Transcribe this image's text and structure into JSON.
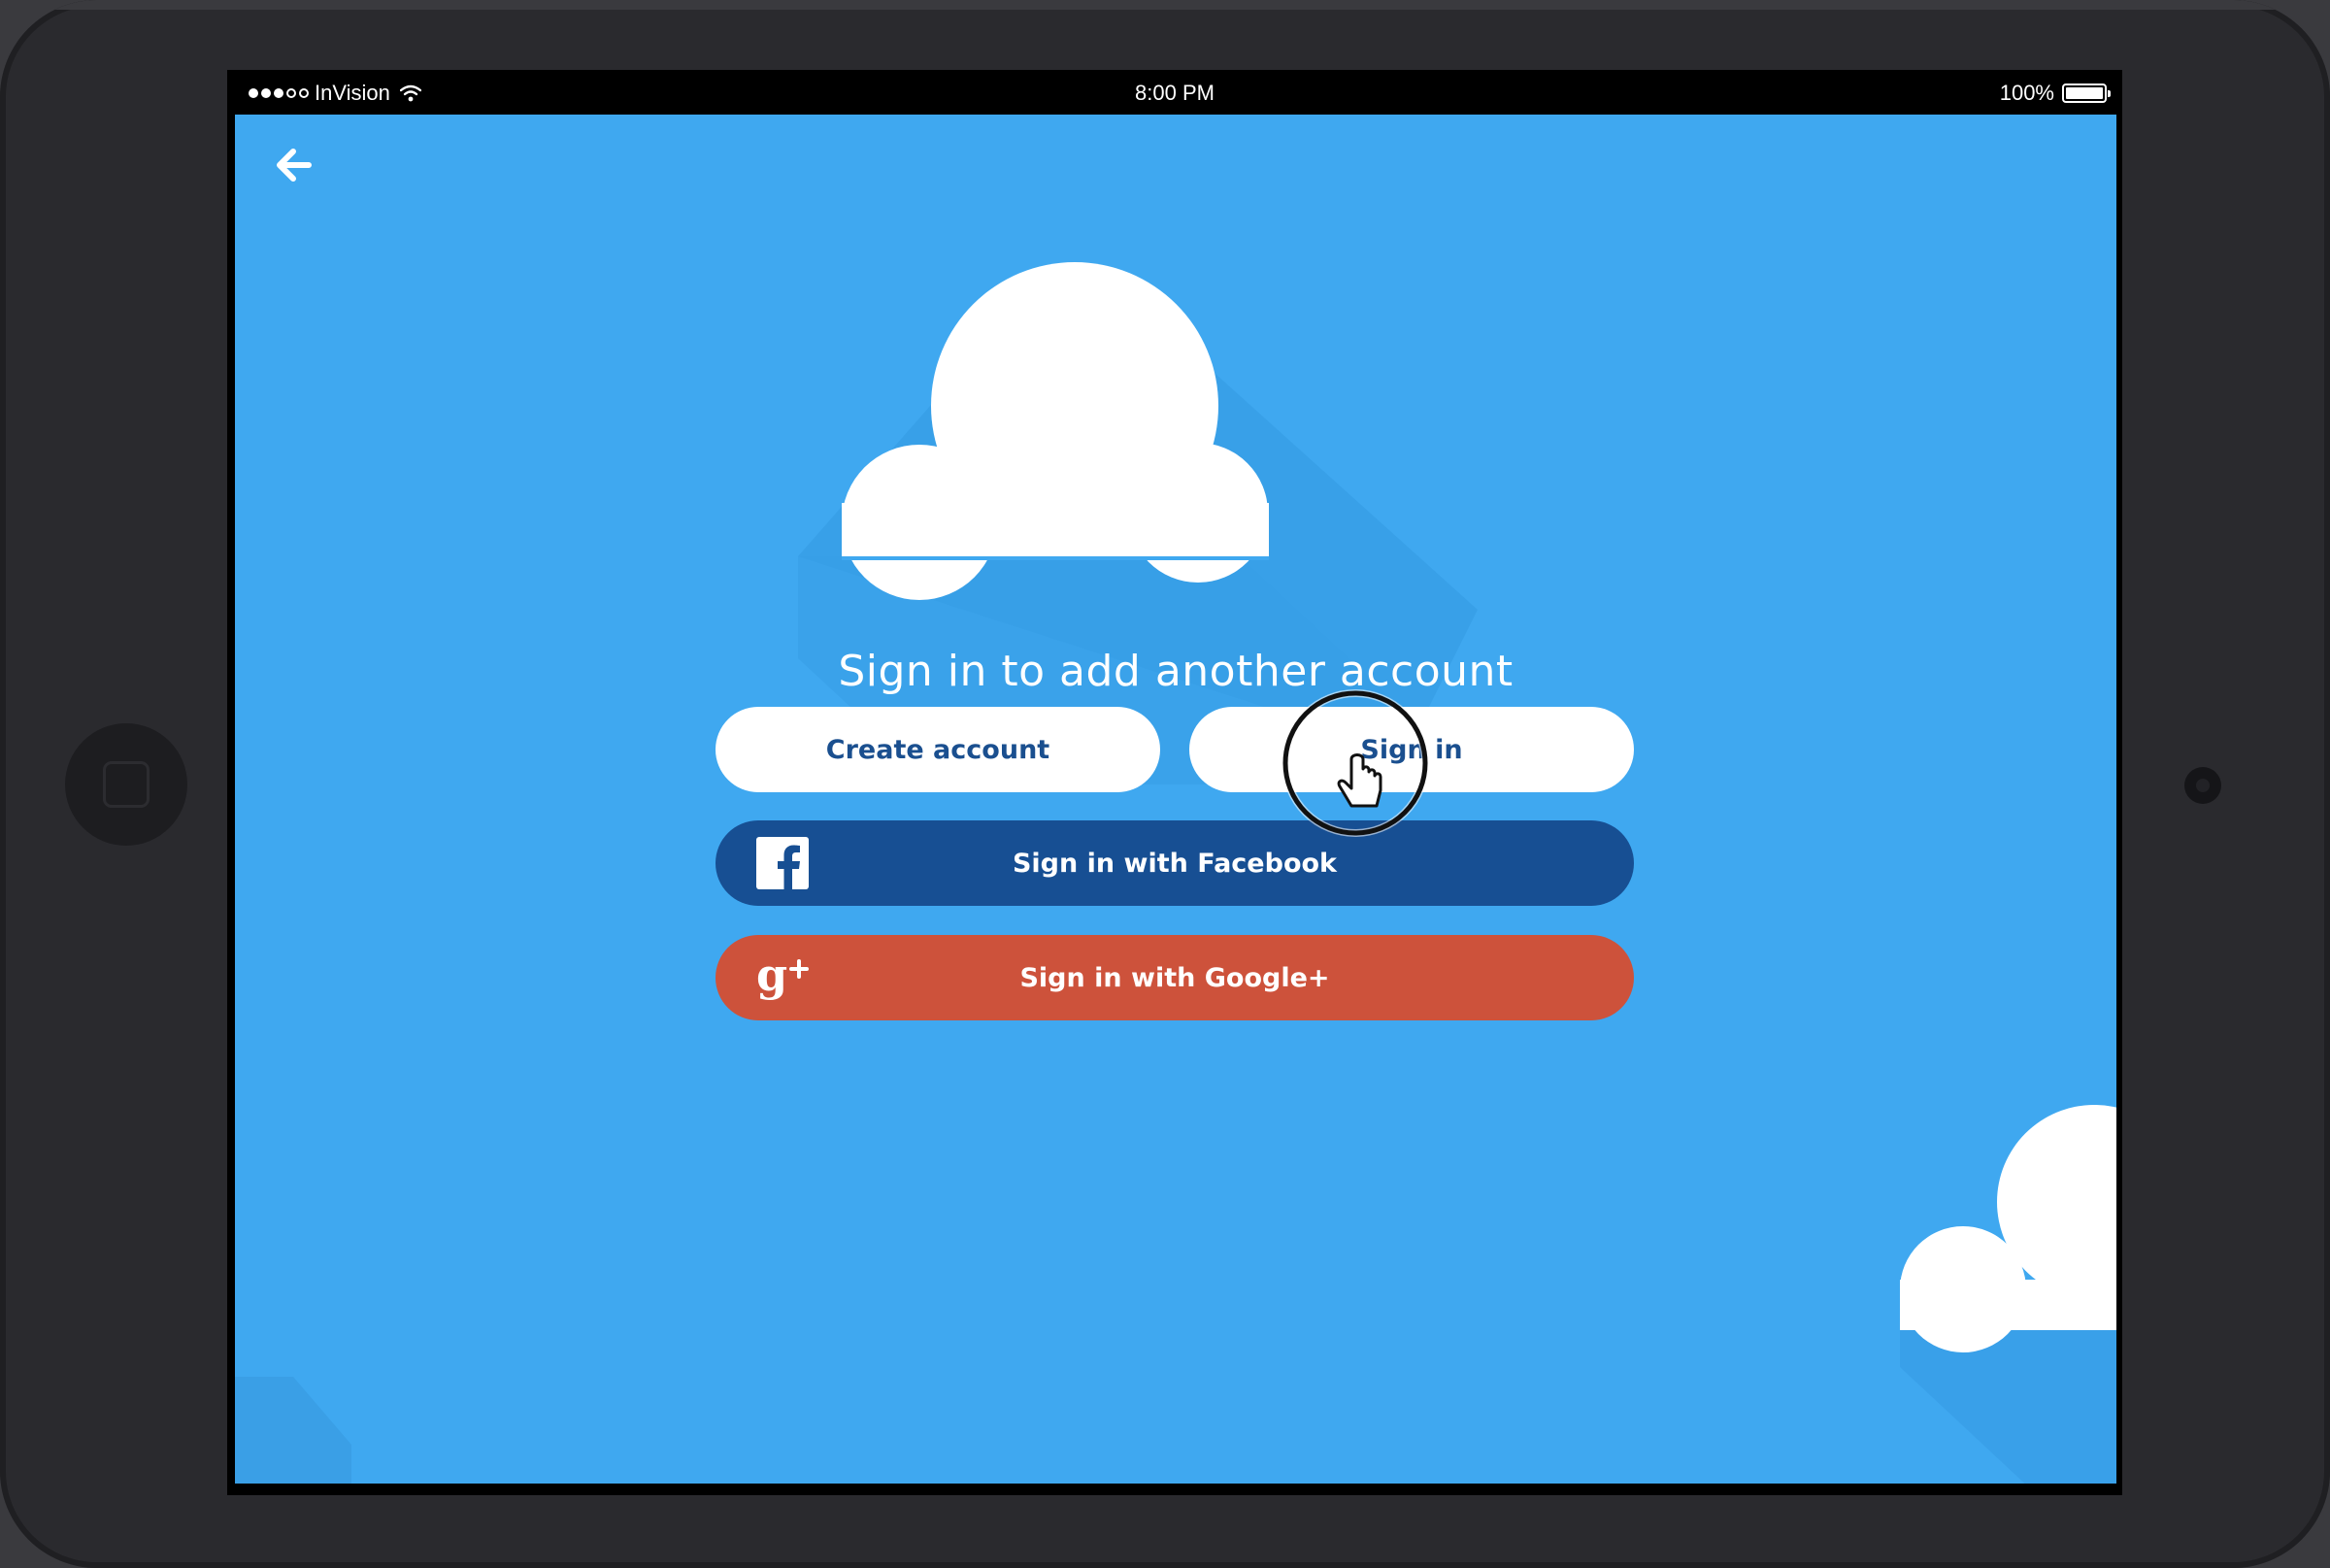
{
  "statusbar": {
    "carrier": "InVision",
    "time": "8:00 PM",
    "battery": "100%"
  },
  "icons": {
    "back": "arrow-left-icon",
    "facebook": "facebook-icon",
    "google": "google-plus-icon",
    "cursor": "hand-pointer-icon"
  },
  "screen": {
    "headline": "Sign in to add another account",
    "create_account_label": "Create account",
    "sign_in_label": "Sign in",
    "facebook_label": "Sign in with Facebook",
    "google_label": "Sign in with Google+"
  },
  "colors": {
    "background": "#3fa8f0",
    "cloud": "#ffffff",
    "facebook": "#174f93",
    "google": "#cd523b",
    "button_text": "#1a4f8f"
  }
}
